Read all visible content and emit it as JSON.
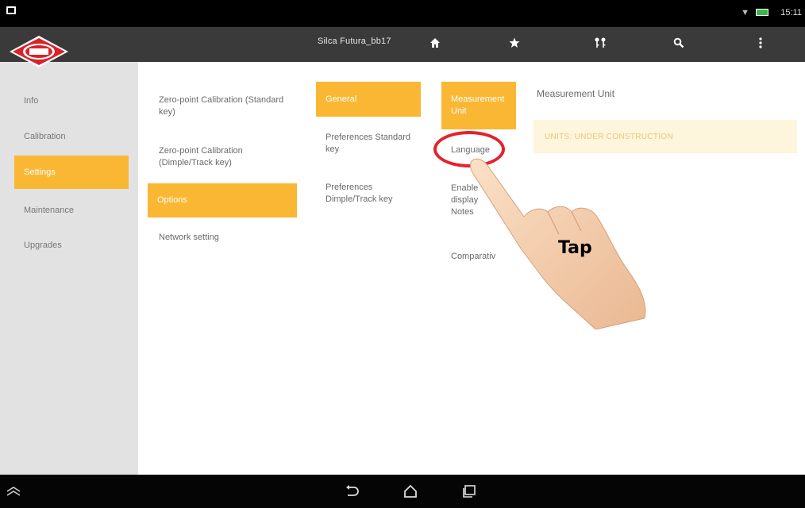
{
  "status_bar": {
    "time": "15:11"
  },
  "header": {
    "device_name": "Silca Futura_bb17",
    "icons": [
      "home-icon",
      "star-icon",
      "keys-icon",
      "search-icon",
      "overflow-menu-icon"
    ]
  },
  "sidebar": {
    "items": [
      {
        "label": "Info",
        "active": false
      },
      {
        "label": "Calibration",
        "active": false
      },
      {
        "label": "Settings",
        "active": true
      },
      {
        "label": "Maintenance",
        "active": false
      },
      {
        "label": "Upgrades",
        "active": false
      }
    ]
  },
  "settings_menu": {
    "items": [
      {
        "label": "Zero-point Calibration (Standard key)",
        "active": false
      },
      {
        "label": "Zero-point Calibration (Dimple/Track key)",
        "active": false
      },
      {
        "label": "Options",
        "active": true
      },
      {
        "label": "Network setting",
        "active": false
      }
    ]
  },
  "options_menu": {
    "items": [
      {
        "label": "General",
        "active": true
      },
      {
        "label": "Preferences Standard key",
        "active": false
      },
      {
        "label": "Preferences Dimple/Track key",
        "active": false
      }
    ]
  },
  "general_menu": {
    "items": [
      {
        "label": "Measurement Unit",
        "active": true
      },
      {
        "label": "Language",
        "active": false
      },
      {
        "label": "Enable display Notes",
        "active": false
      },
      {
        "label": "Comparativ",
        "active": false
      }
    ]
  },
  "detail_panel": {
    "title": "Measurement Unit",
    "message": "UNITS: UNDER CONSTRUCTION"
  },
  "overlay": {
    "tap_label": "Tap"
  },
  "colors": {
    "accent": "#f9b733",
    "topbar": "#3a3a3a",
    "sidebar": "#e2e2e2",
    "highlight_circle": "#e4222b"
  }
}
